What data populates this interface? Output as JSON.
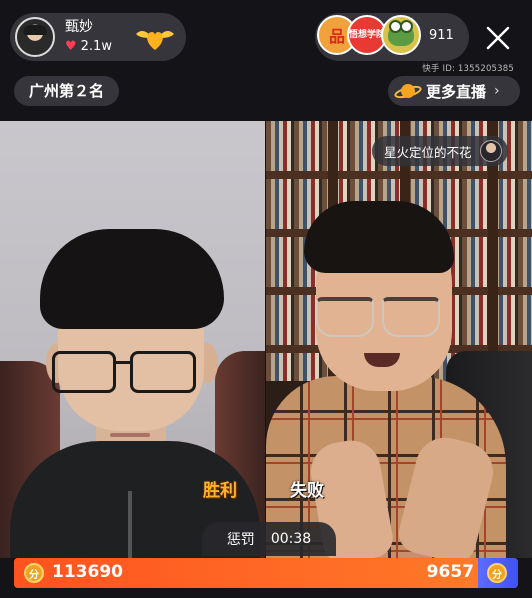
{
  "host": {
    "name": "甄妙",
    "likes": "2.1w"
  },
  "viewers": {
    "avatar1_text": "品",
    "avatar2_text": "悟想学院",
    "count": "911"
  },
  "watermark": "快手 ID: 1355205385",
  "rank": {
    "label": "广州第２名"
  },
  "more_live": {
    "label": "更多直播"
  },
  "pk": {
    "opponent_name": "星火定位的不花",
    "left_result": "胜利",
    "right_result": "失败",
    "punish_label": "惩罚",
    "timer": "00:38",
    "score_left": "113690",
    "score_right": "9657",
    "left_share": 0.922,
    "coin_glyph": "分"
  },
  "colors": {
    "win": "#ffb22d",
    "bar_left": "#ff6322",
    "bar_right": "#4a5cf7",
    "heart": "#ff3d55"
  }
}
